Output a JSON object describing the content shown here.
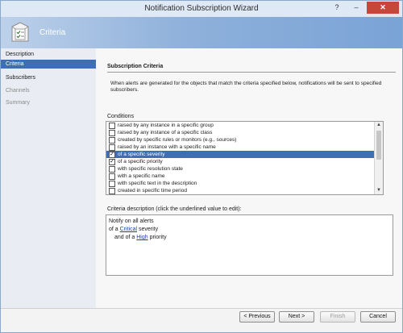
{
  "window": {
    "title": "Notification Subscription Wizard"
  },
  "title_buttons": {
    "help": "?",
    "minimize": "–",
    "close": "✕"
  },
  "banner": {
    "text": "Criteria",
    "icon": "checklist-icon"
  },
  "sidebar": {
    "items": [
      {
        "label": "Description",
        "state": "normal"
      },
      {
        "label": "Criteria",
        "state": "selected"
      },
      {
        "label": "Subscribers",
        "state": "normal"
      },
      {
        "label": "Channels",
        "state": "disabled"
      },
      {
        "label": "Summary",
        "state": "disabled"
      }
    ]
  },
  "main": {
    "section_title": "Subscription Criteria",
    "intro": "When alerts are generated for the objects that match the criteria specified below, notifications will be sent to specified subscribers.",
    "conditions_label": "Conditions",
    "conditions": [
      {
        "label": "raised by any instance in a specific group",
        "checked": false
      },
      {
        "label": "raised by any instance of a specific class",
        "checked": false
      },
      {
        "label": "created by specific rules or monitors (e.g., sources)",
        "checked": false
      },
      {
        "label": "raised by an instance with a specific name",
        "checked": false
      },
      {
        "label": "of a specific severity",
        "checked": true,
        "selected": true
      },
      {
        "label": "of a specific priority",
        "checked": true
      },
      {
        "label": "with specific resolution state",
        "checked": false
      },
      {
        "label": "with a specific name",
        "checked": false
      },
      {
        "label": "with specific text in the description",
        "checked": false
      },
      {
        "label": "created in specific time period",
        "checked": false
      }
    ],
    "criteria_label": "Criteria description (click the underlined value to edit):",
    "criteria": {
      "line1": "Notify on all alerts",
      "line2_prefix": "of a ",
      "line2_link": "Critical",
      "line2_suffix": " severity",
      "line3_prefix": "and of a ",
      "line3_link": "High",
      "line3_suffix": " priority"
    }
  },
  "buttons": {
    "previous": "< Previous",
    "next": "Next >",
    "finish": "Finish",
    "cancel": "Cancel"
  }
}
